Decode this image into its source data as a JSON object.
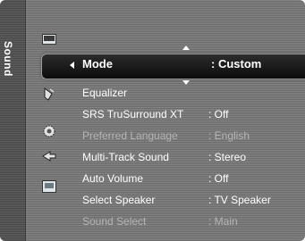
{
  "side_tab": {
    "label": "Sound"
  },
  "icons": [
    {
      "name": "picture-icon"
    },
    {
      "name": "sound-icon"
    },
    {
      "name": "channel-icon"
    },
    {
      "name": "setup-icon"
    },
    {
      "name": "input-icon"
    },
    {
      "name": "application-icon"
    }
  ],
  "selected": {
    "label": "Mode",
    "value": ": Custom"
  },
  "items": [
    {
      "label": "Equalizer",
      "value": "",
      "enabled": true
    },
    {
      "label": "SRS TruSurround XT",
      "value": ": Off",
      "enabled": true
    },
    {
      "label": "Preferred Language",
      "value": ": English",
      "enabled": false
    },
    {
      "label": "Multi-Track Sound",
      "value": ": Stereo",
      "enabled": true
    },
    {
      "label": "Auto Volume",
      "value": ": Off",
      "enabled": true
    },
    {
      "label": "Select Speaker",
      "value": ": TV Speaker",
      "enabled": true
    },
    {
      "label": "Sound Select",
      "value": ": Main",
      "enabled": false
    }
  ],
  "colors": {
    "text": "#ffffff",
    "disabled_text": "#b5b5b5",
    "highlight_bar": "#111111",
    "background": "#7a7a7a"
  }
}
